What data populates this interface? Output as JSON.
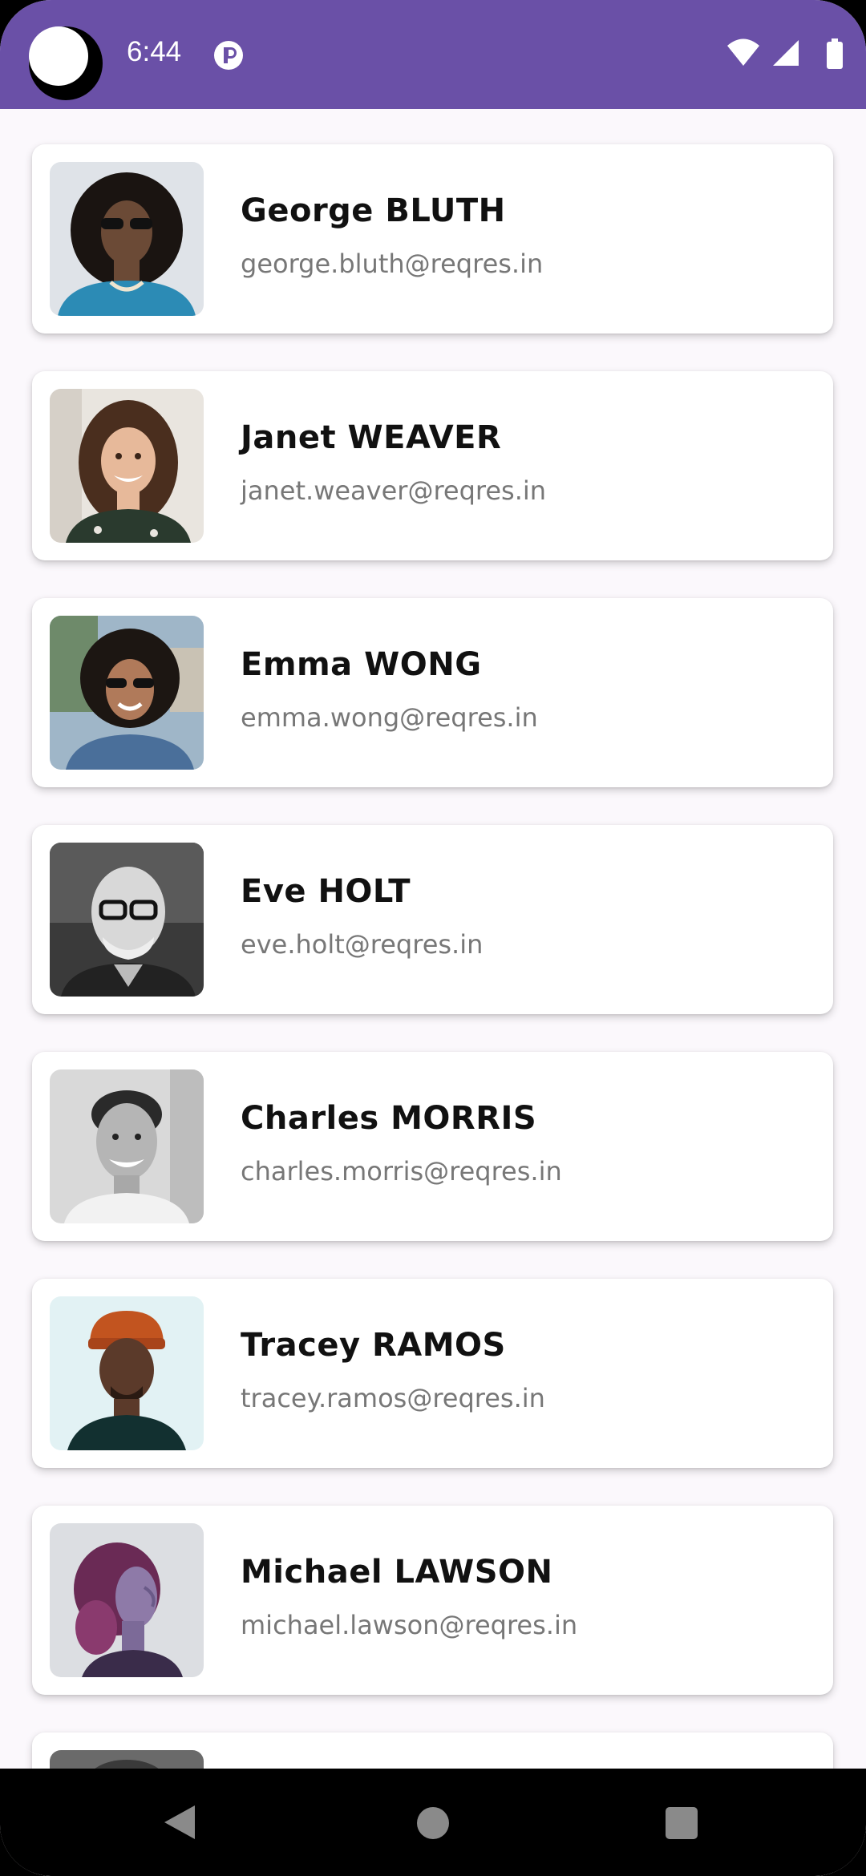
{
  "status_bar": {
    "time": "6:44",
    "background_color": "#6a50a7",
    "icons": [
      "wifi-icon",
      "signal-icon",
      "battery-icon"
    ]
  },
  "users": [
    {
      "name": "George BLUTH",
      "email": "george.bluth@reqres.in",
      "avatar": "avatar-george"
    },
    {
      "name": "Janet WEAVER",
      "email": "janet.weaver@reqres.in",
      "avatar": "avatar-janet"
    },
    {
      "name": "Emma WONG",
      "email": "emma.wong@reqres.in",
      "avatar": "avatar-emma"
    },
    {
      "name": "Eve HOLT",
      "email": "eve.holt@reqres.in",
      "avatar": "avatar-eve"
    },
    {
      "name": "Charles MORRIS",
      "email": "charles.morris@reqres.in",
      "avatar": "avatar-charles"
    },
    {
      "name": "Tracey RAMOS",
      "email": "tracey.ramos@reqres.in",
      "avatar": "avatar-tracey"
    },
    {
      "name": "Michael LAWSON",
      "email": "michael.lawson@reqres.in",
      "avatar": "avatar-michael"
    }
  ],
  "navigation": {
    "buttons": [
      "back-button",
      "home-button",
      "recents-button"
    ]
  }
}
